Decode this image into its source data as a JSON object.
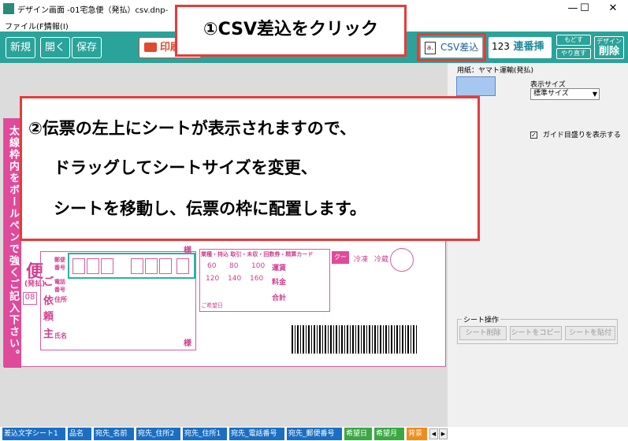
{
  "window": {
    "title": "デザイン画面 -01宅急便（発払）csv.dnp-",
    "minimize": "—",
    "maximize": "☐",
    "close": "✕"
  },
  "menu": {
    "file": "ファイル(F)",
    "info": "情報(I)"
  },
  "toolbar": {
    "new": "新規",
    "open": "開く",
    "save": "保存",
    "print": "印刷",
    "csv": "CSV差込",
    "csv_icon": "a.",
    "renban_num": "123",
    "renban": "連番挿入",
    "undo": "もどす",
    "redo": "やり直す",
    "delete_top": "デザイン",
    "delete": "削除"
  },
  "callouts": {
    "step1": "①CSV差込をクリック",
    "step2_line1": "②伝票の左上にシートが表示されますので、",
    "step2_line2": "ドラッグしてシートサイズを変更、",
    "step2_line3": "シートを移動し、伝票の枠に配置します。"
  },
  "panel": {
    "paper_label": "用紙：ヤマト運輸(発払)",
    "display_size_label": "表示サイズ",
    "display_size_value": "標準サイズ",
    "guide_label": "ガイド目盛りを表示する",
    "guide_check": "✓",
    "sheet_ops_label": "シート操作",
    "sheet_delete": "シート削除",
    "sheet_copy": "シートをコピー",
    "sheet_paste": "シートを貼付"
  },
  "slip": {
    "side_text": "太線枠内をボールペンで強くご記入下さい。",
    "bin": "便",
    "hatsu": "(発払)",
    "ko": "ご",
    "irai": "依",
    "rai": "頼",
    "nushi": "主",
    "yubin": "郵便番号",
    "denwa": "電話番号",
    "jusho": "住所",
    "shimei": "氏名",
    "sama1": "様",
    "sama2": "様",
    "num08": "08",
    "headers": "業種・持込 取引・未収・回数券・精算カード",
    "r1": [
      "60",
      "80",
      "100"
    ],
    "r2": [
      "120",
      "140",
      "160"
    ],
    "unchin": "運賃",
    "ryokin": "料金",
    "goukei": "合計",
    "cool": "クール",
    "reitou": "冷凍",
    "reizou": "冷蔵",
    "kibou": "ご希望日"
  },
  "tabs": [
    {
      "label": "差込文字シート1",
      "color": "#1a6fc4"
    },
    {
      "label": "品名",
      "color": "#1a6fc4"
    },
    {
      "label": "宛先_名前",
      "color": "#1a6fc4"
    },
    {
      "label": "宛先_住所2",
      "color": "#1a6fc4"
    },
    {
      "label": "宛先_住所1",
      "color": "#1a6fc4"
    },
    {
      "label": "宛先_電話番号",
      "color": "#1a6fc4"
    },
    {
      "label": "宛先_郵便番号",
      "color": "#1a6fc4"
    },
    {
      "label": "希望日",
      "color": "#3aa843"
    },
    {
      "label": "希望月",
      "color": "#3aa843"
    },
    {
      "label": "背景",
      "color": "#f08c1a"
    }
  ],
  "nav": {
    "prev": "◀",
    "next": "▶"
  }
}
